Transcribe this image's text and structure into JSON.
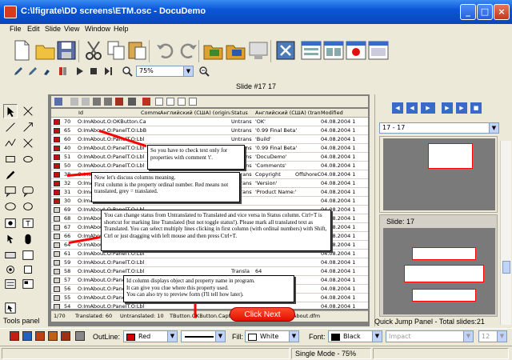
{
  "window": {
    "title": "C:\\lfigrate\\DD screens\\ETM.osc - DocuDemo",
    "min": "_",
    "max": "□",
    "close": "×"
  },
  "menu": [
    "File",
    "Edit",
    "Slide",
    "View",
    "Window",
    "Help"
  ],
  "toolbar": {
    "zoom": "75%"
  },
  "slide_header": "Slide #17  17",
  "grid": {
    "headers": [
      "Id",
      "Comme",
      "Английский (США) (original)",
      "Status",
      "Английский (США) (translate",
      "Modified"
    ],
    "rows": [
      {
        "num": "70",
        "id": "O:ImAbout.O:OKButton.Ca",
        "status": "Untrans",
        "trans": "'OK'",
        "date": "04.08.2004 1",
        "sq": "#c01010"
      },
      {
        "num": "65",
        "id": "O:ImAbout.O:PanelT.O:LbB",
        "status": "Untrans",
        "trans": "'0.99 Final Beta'",
        "date": "04.08.2004 1",
        "sq": "#c01010"
      },
      {
        "num": "60",
        "id": "O:ImAbout.O:PanelT.O:Lbl",
        "status": "Untrans",
        "trans": "'Build'",
        "date": "04.08.2004 1",
        "sq": "#c01010"
      },
      {
        "num": "40",
        "id": "O:ImAbout.O:PanelT.O:Lbl",
        "status": "Untrans",
        "trans": "'0.99 Final Beta'",
        "date": "04.08.2004 1",
        "sq": "#c01010"
      },
      {
        "num": "51",
        "id": "O:ImAbout.O:PanelT.O:Lbl",
        "status": "Untrans",
        "trans": "'DocuDemo'",
        "date": "04.08.2004 1",
        "sq": "#c01010"
      },
      {
        "num": "50",
        "id": "O:ImAbout.O:PanelT.O:Lbl",
        "status": "Untrans",
        "trans": "'Comments'",
        "date": "04.08.2004 1",
        "sq": "#c01010"
      },
      {
        "num": "38",
        "id": "O:ImAbout.O:PanelT.O:Lbl",
        "status": "Untrans",
        "trans": "Copyright",
        "extra": "OffshoreCre",
        "date": "04.08.2004 1",
        "sq": "#c01010"
      },
      {
        "num": "32",
        "id": "O:ImAbout.O:PanelT.O:Lbl",
        "status": "Untrans",
        "trans": "'Version'",
        "date": "04.08.2004 1",
        "sq": "#c01010"
      },
      {
        "num": "31",
        "id": "O:ImAbout.O:PanelT.O:Lbl",
        "status": "Untrans",
        "trans": "'Product Name:'",
        "date": "04.08.2004 1",
        "sq": "#c01010"
      },
      {
        "num": "30",
        "id": "O:ImAbout.O:PanelT.O:Lbl",
        "status": "",
        "trans": "",
        "date": "04.08.2004 1",
        "sq": "#c01010"
      },
      {
        "num": "69",
        "id": "O:ImAbout.O:PanelT.O:Lbl",
        "status": "",
        "trans": "",
        "date": "04.08.2004 1",
        "sq": "#d4d0c8"
      },
      {
        "num": "68",
        "id": "O:ImAbout.O:PanelT.O:Lbl",
        "status": "",
        "trans": "",
        "date": "04.08.2004 1",
        "sq": "#d4d0c8"
      },
      {
        "num": "67",
        "id": "O:ImAbout.O:PanelT.O:Lbl",
        "status": "",
        "trans": "",
        "date": "04.08.2004 1",
        "sq": "#d4d0c8"
      },
      {
        "num": "66",
        "id": "O:ImAbout.O:PanelT.O:Lbl",
        "status": "",
        "trans": "",
        "date": "04.08.2004 1",
        "sq": "#d4d0c8"
      },
      {
        "num": "64",
        "id": "O:ImAbout.O:PanelT.O:Lbl",
        "status": "",
        "trans": "",
        "date": "04.08.2004 1",
        "sq": "#d4d0c8"
      },
      {
        "num": "61",
        "id": "O:ImAbout.O:PanelT.O:Lbl",
        "status": "",
        "trans": "",
        "date": "04.08.2004 1",
        "sq": "#d4d0c8"
      },
      {
        "num": "59",
        "id": "O:ImAbout.O:PanelT.O:Lbl",
        "status": "",
        "trans": "",
        "date": "04.08.2004 1",
        "sq": "#d4d0c8"
      },
      {
        "num": "58",
        "id": "O:ImAbout.O:PanelT.O:Lbl",
        "status": "Transla",
        "trans": "64",
        "date": "04.08.2004 1",
        "sq": "#d4d0c8"
      },
      {
        "num": "57",
        "id": "O:ImAbout.O:PanelT.O:Lbl",
        "status": "Transla",
        "trans": "160",
        "date": "04.08.2004 1",
        "sq": "#d4d0c8"
      },
      {
        "num": "56",
        "id": "O:ImAbout.O:PanelT.O:Lbl",
        "status": "",
        "trans": "",
        "date": "04.08.2004 1",
        "sq": "#d4d0c8"
      },
      {
        "num": "55",
        "id": "O:ImAbout.O:PanelT.O:Lbl",
        "status": "",
        "trans": "",
        "date": "04.08.2004 1",
        "sq": "#d4d0c8"
      },
      {
        "num": "54",
        "id": "O:ImAbout.O:PanelT.O:Lbl",
        "status": "",
        "trans": "",
        "date": "04.08.2004 1",
        "sq": "#d4d0c8"
      }
    ],
    "status_bar": {
      "pos": "1/70",
      "translated": "Translated: 60",
      "untranslated": "Untranslated: 10",
      "current": "TButton.OKButton.Caption",
      "file": "About.dfm"
    }
  },
  "callouts": {
    "c1": "So you have to check text only for properties with comment 't'.",
    "c2": "Now let's discuss columns meaning.\nFirst column is the property ordinal number. Red means not translated, grey = translated.",
    "c3": "You can change status from Untranslated to Translated and vice versa in Status column. Ctrl+T is shortcut for marking line Translated (but not toggle status!). Please mark all translated text as Translated. You can select multiply lines clicking in first column (with ordinal numbers) with Shift, Ctrl or just dragging with left mouse and then press Ctrl+T.",
    "c4": "Id column displays object and property name in program.\nIt can give you clue where this property used.\nYou can also try to preview form (I'll tell how later)."
  },
  "click_next": "Click Next",
  "tools_panel_label": "Tools panel",
  "right_panel": {
    "select_value": "17 - 17",
    "slide_label": "Slide:  17",
    "footer": "Quick Jump Panel - Total slides:21"
  },
  "bottom": {
    "outline_label": "OutLine:",
    "outline_value": "Red",
    "outline_color": "#d40000",
    "fill_label": "Fill:",
    "fill_value": "White",
    "fill_color": "#ffffff",
    "font_label": "Font:",
    "font_value": "Black",
    "font_color": "#000000",
    "font_name": "Impact",
    "font_size": "12"
  },
  "status": {
    "mode": "Single Mode - 75%"
  }
}
